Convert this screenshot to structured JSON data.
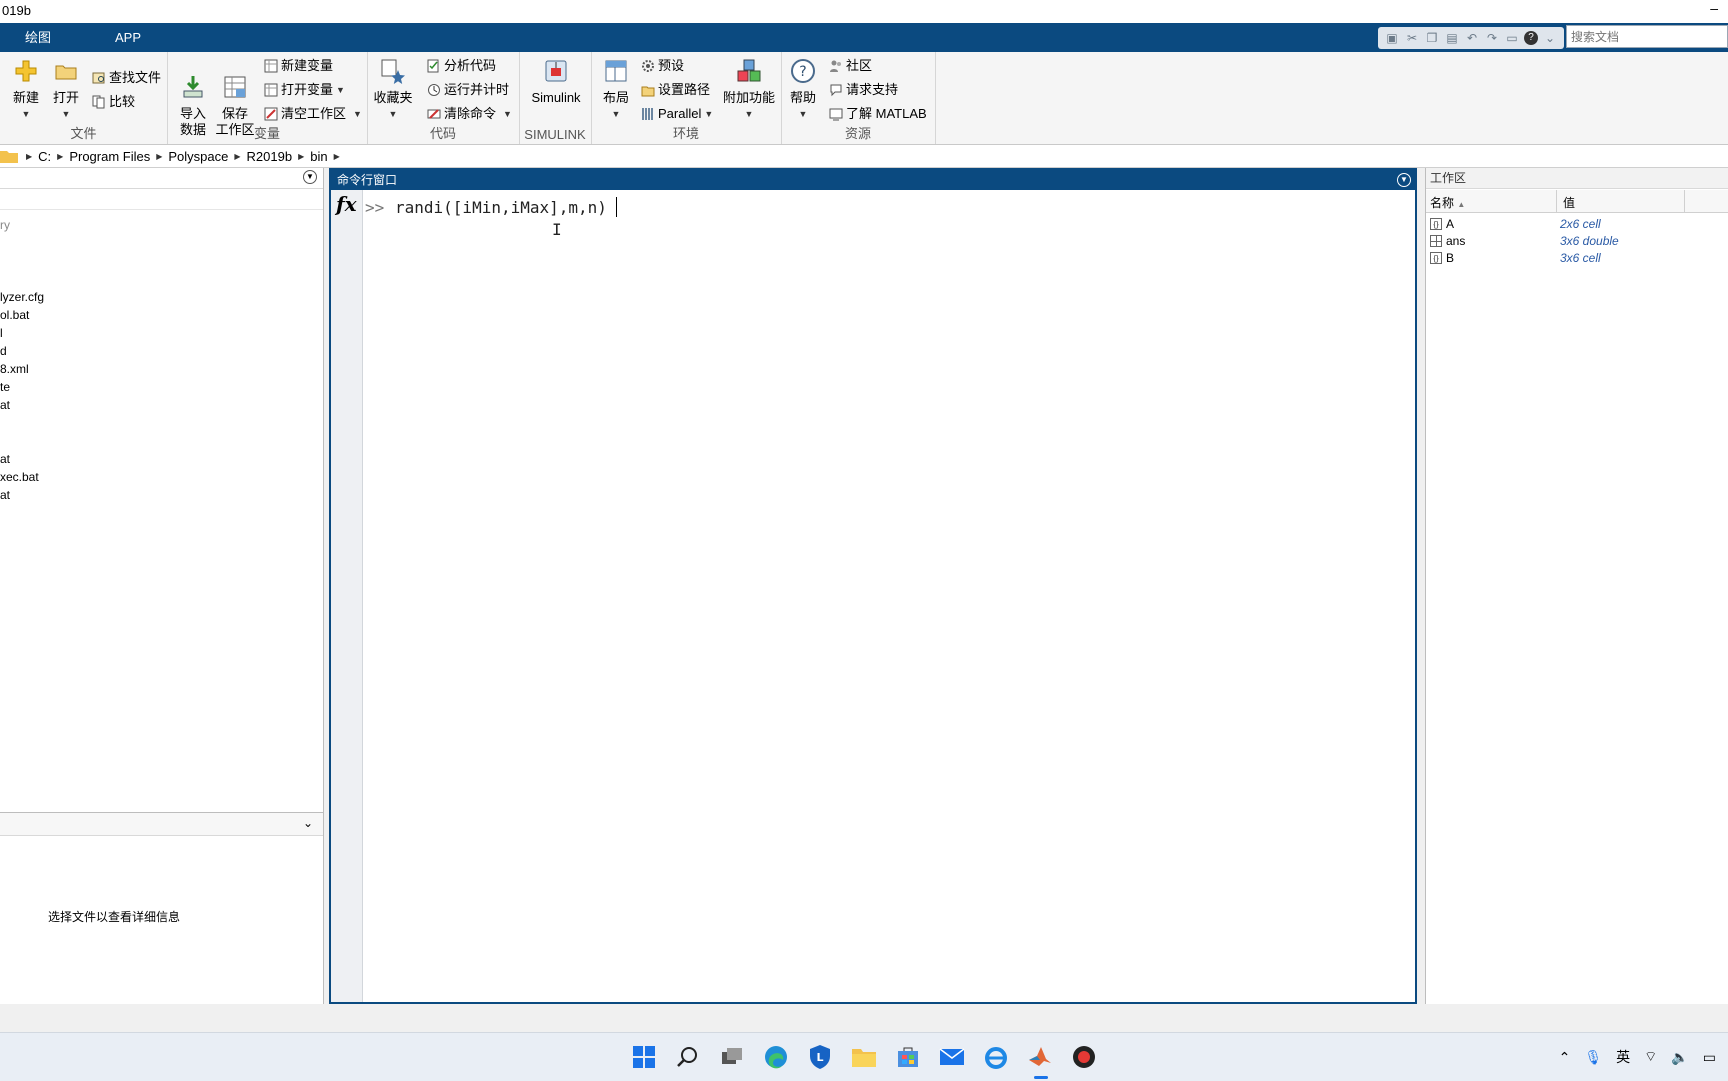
{
  "title": "019b",
  "tabs": [
    "绘图",
    "APP"
  ],
  "search": {
    "placeholder": "搜索文档"
  },
  "ribbon": {
    "file": {
      "label": "文件",
      "new": "新建",
      "open": "打开",
      "find_files": "查找文件",
      "compare": "比较"
    },
    "variable": {
      "label": "变量",
      "import_data": "导入\n数据",
      "save_workspace": "保存\n工作区",
      "new_variable": "新建变量",
      "open_variable": "打开变量",
      "clear_workspace": "清空工作区"
    },
    "code": {
      "label": "代码",
      "favorites": "收藏夹",
      "analyze_code": "分析代码",
      "run_and_time": "运行并计时",
      "clear_commands": "清除命令"
    },
    "simulink": {
      "label": "SIMULINK",
      "simulink": "Simulink"
    },
    "environment": {
      "label": "环境",
      "layout": "布局",
      "preferences": "预设",
      "set_path": "设置路径",
      "parallel": "Parallel",
      "addons": "附加功能"
    },
    "resources": {
      "label": "资源",
      "help": "帮助",
      "community": "社区",
      "request_support": "请求支持",
      "learn_matlab": "了解 MATLAB"
    }
  },
  "address": [
    "C:",
    "Program Files",
    "Polyspace",
    "R2019b",
    "bin"
  ],
  "left_panel": {
    "files": [
      "ry",
      "",
      "",
      "",
      "lyzer.cfg",
      "ol.bat",
      "l",
      "d",
      "8.xml",
      "te",
      "at",
      "",
      "",
      "at",
      "xec.bat",
      "at"
    ],
    "details_text": "选择文件以查看详细信息"
  },
  "command_window": {
    "title": "命令行窗口",
    "prompt": ">>",
    "command": "randi([iMin,iMax],m,n)"
  },
  "workspace": {
    "title": "工作区",
    "col_name": "名称",
    "col_value": "值",
    "rows": [
      {
        "name": "A",
        "value": "2x6 cell",
        "icon": "cell-icon"
      },
      {
        "name": "ans",
        "value": "3x6 double",
        "icon": "matrix-icon"
      },
      {
        "name": "B",
        "value": "3x6 cell",
        "icon": "cell-icon"
      }
    ]
  },
  "tray": {
    "ime": "英"
  },
  "colors": {
    "accent": "#0b4a80",
    "workspace_value": "#2a5aa5"
  }
}
